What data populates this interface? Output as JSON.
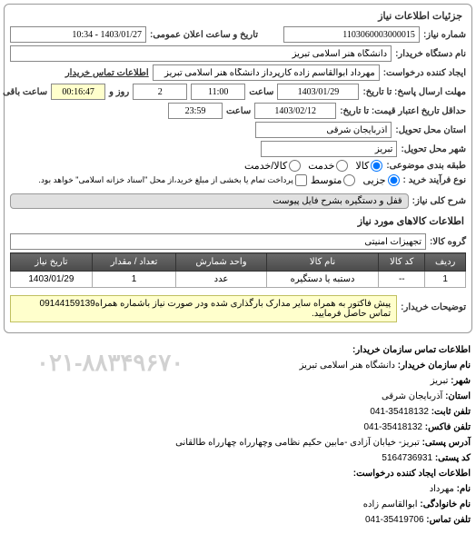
{
  "panel_title": "جزئیات اطلاعات نیاز",
  "header": {
    "l_req_no": "شماره نیاز:",
    "req_no": "1103060003000015",
    "l_announce_dt": "تاریخ و ساعت اعلان عمومی:",
    "announce_dt": "1403/01/27 - 10:34",
    "l_buyer_org": "نام دستگاه خریدار:",
    "buyer_org": "دانشگاه هنر اسلامی تبریز",
    "l_requester": "ایجاد کننده درخواست:",
    "requester": "مهرداد ابوالقاسم زاده کارپرداز دانشگاه هنر اسلامی تبریز",
    "l_buyer_contact": "اطلاعات تماس خریدار",
    "l_resp_deadline": "مهلت ارسال پاسخ: تا تاریخ:",
    "resp_date": "1403/01/29",
    "l_time": "ساعت",
    "resp_time": "11:00",
    "remain_days": "2",
    "l_day_and": "روز و",
    "remain_time": "00:16:47",
    "l_remain": "ساعت باقی مانده",
    "l_valid_until": "حداقل تاریخ اعتبار قیمت: تا تاریخ:",
    "valid_date": "1403/02/12",
    "valid_time": "23:59",
    "l_province": "استان محل تحویل:",
    "province": "آذربایجان شرقی",
    "l_city": "شهر محل تحویل:",
    "city": "تبریز",
    "l_category": "طبقه بندی موضوعی:",
    "opt_goods": "کالا",
    "opt_service": "خدمت",
    "opt_goods_service": "کالا/خدمت",
    "l_proc_type": "نوع فرآیند خرید :",
    "opt_minor": "جزیی",
    "opt_medium": "متوسط",
    "proc_note": "پرداخت تمام یا بخشی از مبلغ خرید،از محل \"اسناد خزانه اسلامی\" خواهد بود.",
    "l_title": "شرح کلی نیاز:",
    "title": "قفل و دستگیره بشرح فایل پیوست"
  },
  "goods": {
    "section_title": "اطلاعات کالاهای مورد نیاز",
    "l_group": "گروه کالا:",
    "group": "تجهیزات امنیتی",
    "cols": {
      "row": "ردیف",
      "code": "کد کالا",
      "name": "نام کالا",
      "unit": "واحد شمارش",
      "qty": "تعداد / مقدار",
      "date": "تاریخ نیاز"
    },
    "rows": [
      {
        "row": "1",
        "code": "--",
        "name": "دستبه یا دستگیره",
        "unit": "عدد",
        "qty": "1",
        "date": "1403/01/29"
      }
    ],
    "buyer_note_label": "توضیحات خریدار:",
    "buyer_note": "پیش فاکتور به همراه سایر مدارک بارگذاری شده ودر صورت نیاز باشماره همراه09144159139 تماس حاصل فرمایید."
  },
  "contact": {
    "section_title": "اطلاعات تماس سازمان خریدار:",
    "l_org": "نام سازمان خریدار:",
    "org": "دانشگاه هنر اسلامی تبریز",
    "l_city": "شهر:",
    "city": "تبریز",
    "l_province": "استان:",
    "province": "آذربایجان شرقی",
    "l_phone": "تلفن ثابت:",
    "phone": "35418132-041",
    "l_fax": "تلفن فاکس:",
    "fax": "35418132-041",
    "l_address": "آدرس پستی:",
    "address": "تبریز- خیابان آزادی -مابین حکیم نظامی وچهارراه چهارراه طالقانی",
    "l_postal": "کد پستی:",
    "postal": "5164736931",
    "req_section_title": "اطلاعات ایجاد کننده درخواست:",
    "l_fname": "نام:",
    "fname": "مهرداد",
    "l_lname": "نام خانوادگی:",
    "lname": "ابوالقاسم زاده",
    "l_tel": "تلفن تماس:",
    "tel": "35419706-041",
    "watermark": "۰۲۱-۸۸۳۴۹۶۷۰"
  }
}
